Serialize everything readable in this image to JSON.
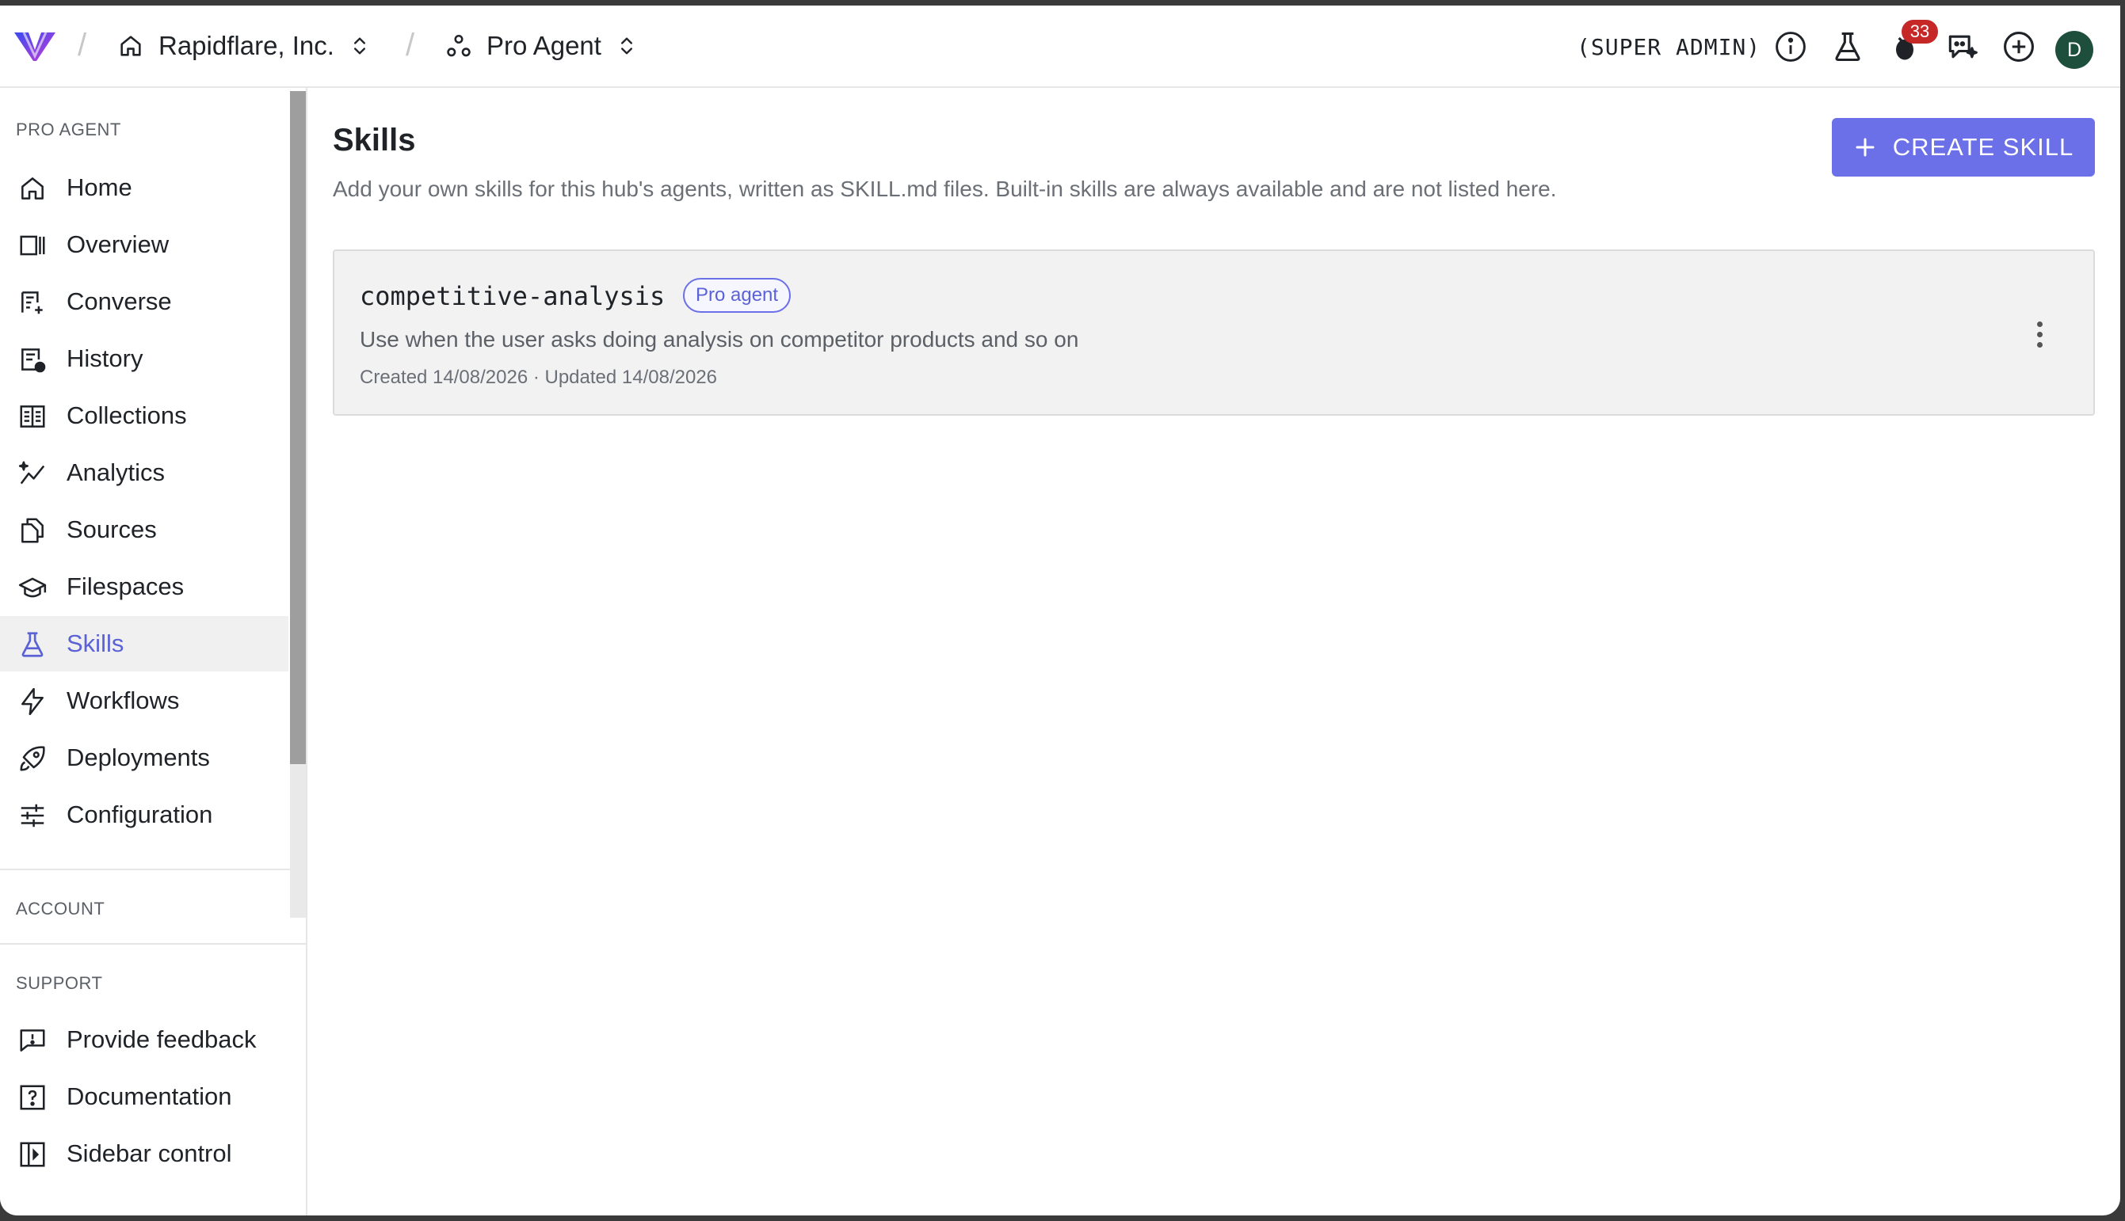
{
  "header": {
    "org_name": "Rapidflare, Inc.",
    "agent_name": "Pro Agent",
    "role": "(SUPER ADMIN)",
    "notification_count": "33",
    "avatar_initial": "D",
    "icons": [
      "info-icon",
      "flask-icon",
      "bug-icon",
      "ai-chat-icon",
      "plus-circle-icon"
    ]
  },
  "sidebar": {
    "section_pro_agent": "PRO AGENT",
    "items": [
      {
        "label": "Home",
        "icon": "home-icon"
      },
      {
        "label": "Overview",
        "icon": "overview-icon"
      },
      {
        "label": "Converse",
        "icon": "converse-icon"
      },
      {
        "label": "History",
        "icon": "history-icon"
      },
      {
        "label": "Collections",
        "icon": "collections-icon"
      },
      {
        "label": "Analytics",
        "icon": "analytics-icon"
      },
      {
        "label": "Sources",
        "icon": "sources-icon"
      },
      {
        "label": "Filespaces",
        "icon": "filespaces-icon"
      },
      {
        "label": "Skills",
        "icon": "flask-icon",
        "active": true
      },
      {
        "label": "Workflows",
        "icon": "lightning-icon"
      },
      {
        "label": "Deployments",
        "icon": "rocket-icon"
      },
      {
        "label": "Configuration",
        "icon": "sliders-icon"
      }
    ],
    "section_account": "ACCOUNT",
    "section_support": "SUPPORT",
    "support_items": [
      {
        "label": "Provide feedback",
        "icon": "feedback-icon"
      },
      {
        "label": "Documentation",
        "icon": "help-icon"
      },
      {
        "label": "Sidebar control",
        "icon": "sidebar-icon"
      }
    ],
    "active_color": "#5b62d6"
  },
  "main": {
    "title": "Skills",
    "description": "Add your own skills for this hub's agents, written as SKILL.md files. Built-in skills are always available and are not listed here.",
    "create_label": "CREATE SKILL",
    "skills": [
      {
        "name": "competitive-analysis",
        "badge": "Pro agent",
        "description": "Use when the user asks doing analysis on competitor products and so on",
        "meta": "Created 14/08/2026 · Updated 14/08/2026"
      }
    ]
  },
  "colors": {
    "accent": "#6b70e8",
    "badge_red": "#c62828",
    "avatar_bg": "#1e4f3c"
  }
}
